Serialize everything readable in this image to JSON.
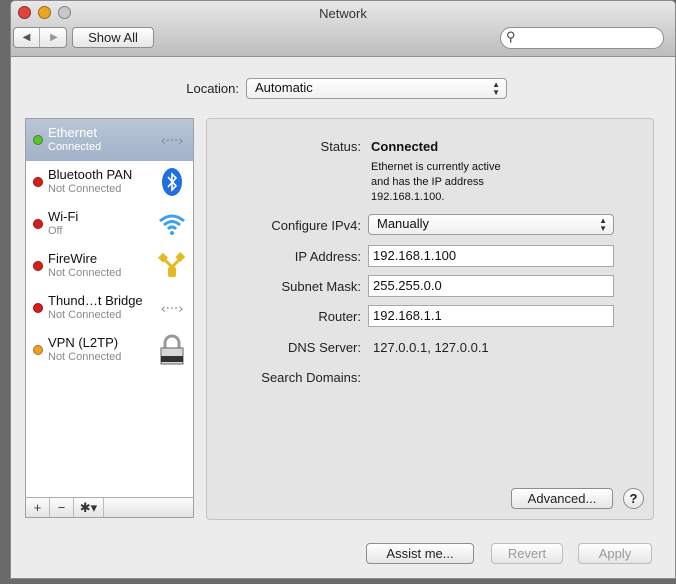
{
  "window": {
    "title": "Network"
  },
  "toolbar": {
    "back_icon": "chevron-left-icon",
    "forward_icon": "chevron-right-icon",
    "show_all_label": "Show All",
    "search_placeholder": ""
  },
  "location": {
    "label": "Location:",
    "value": "Automatic"
  },
  "sidebar": {
    "items": [
      {
        "name": "Ethernet",
        "status": "Connected",
        "dot_color": "#5cc22f",
        "icon": "ethernet-icon",
        "selected": true
      },
      {
        "name": "Bluetooth PAN",
        "status": "Not Connected",
        "dot_color": "#d91c1c",
        "icon": "bluetooth-icon"
      },
      {
        "name": "Wi-Fi",
        "status": "Off",
        "dot_color": "#d91c1c",
        "icon": "wifi-icon"
      },
      {
        "name": "FireWire",
        "status": "Not Connected",
        "dot_color": "#d91c1c",
        "icon": "firewire-icon"
      },
      {
        "name": "Thund…t Bridge",
        "status": "Not Connected",
        "dot_color": "#d91c1c",
        "icon": "thunderbolt-bridge-icon"
      },
      {
        "name": "VPN (L2TP)",
        "status": "Not Connected",
        "dot_color": "#f0a020",
        "icon": "lock-icon"
      }
    ],
    "add_label": "+",
    "remove_label": "−"
  },
  "detail": {
    "status_label": "Status:",
    "status_value": "Connected",
    "status_description": "Ethernet is currently active and has the IP address 192.168.1.100.",
    "configure_label": "Configure IPv4:",
    "configure_value": "Manually",
    "ip_label": "IP Address:",
    "ip_value": "192.168.1.100",
    "subnet_label": "Subnet Mask:",
    "subnet_value": "255.255.0.0",
    "router_label": "Router:",
    "router_value": "192.168.1.1",
    "dns_label": "DNS Server:",
    "dns_value": "127.0.0.1, 127.0.0.1",
    "search_domains_label": "Search Domains:",
    "advanced_label": "Advanced...",
    "help_label": "?"
  },
  "footer": {
    "assist_label": "Assist me...",
    "revert_label": "Revert",
    "apply_label": "Apply"
  }
}
